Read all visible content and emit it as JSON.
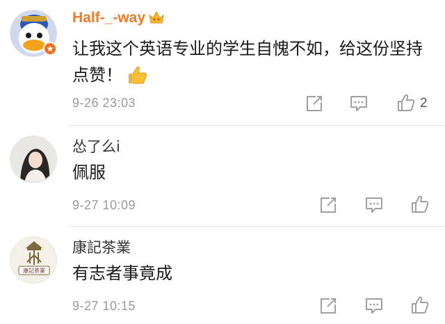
{
  "comments": [
    {
      "username": "Half-_-way",
      "text": "让我这个英语专业的学生自愧不如，给这份坚持点赞！",
      "time": "9-26 23:03",
      "likes": "2",
      "vip": true,
      "verified_badge": true,
      "avatar": "donald-duck-avatar"
    },
    {
      "username": "怂了么i",
      "text": "佩服",
      "time": "9-27 10:09",
      "likes": "",
      "avatar": "portrait-avatar"
    },
    {
      "username": "康記茶業",
      "text": "有志者事竟成",
      "time": "9-27 10:15",
      "likes": "",
      "avatar": "tea-logo-avatar",
      "logo_text": "康記茶業"
    }
  ],
  "colors": {
    "vip_name": "#f07a25",
    "icon_gray": "#a0a0a0",
    "time_gray": "#9a9a9a"
  },
  "icons": {
    "repost": "share-icon",
    "comment": "comment-icon",
    "like": "thumbs-up-icon"
  }
}
